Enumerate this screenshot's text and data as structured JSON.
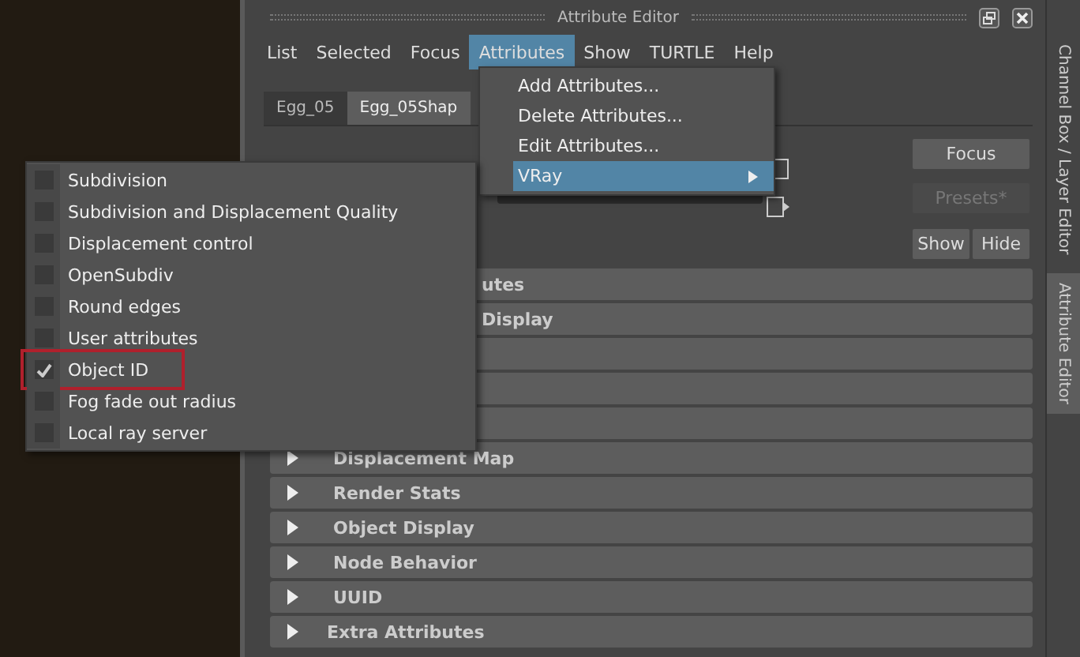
{
  "window": {
    "title": "Attribute Editor"
  },
  "menu_bar": [
    {
      "label": "List",
      "selected": false
    },
    {
      "label": "Selected",
      "selected": false
    },
    {
      "label": "Focus",
      "selected": false
    },
    {
      "label": "Attributes",
      "selected": true
    },
    {
      "label": "Show",
      "selected": false
    },
    {
      "label": "TURTLE",
      "selected": false
    },
    {
      "label": "Help",
      "selected": false
    }
  ],
  "attributes_menu": [
    {
      "label": "Add Attributes...",
      "selected": false,
      "submenu": false
    },
    {
      "label": "Delete Attributes...",
      "selected": false,
      "submenu": false
    },
    {
      "label": "Edit Attributes...",
      "selected": false,
      "submenu": false
    },
    {
      "label": "VRay",
      "selected": true,
      "submenu": true
    }
  ],
  "vray_submenu": [
    {
      "label": "Subdivision",
      "checked": false,
      "highlighted": false
    },
    {
      "label": "Subdivision and Displacement Quality",
      "checked": false,
      "highlighted": false
    },
    {
      "label": "Displacement control",
      "checked": false,
      "highlighted": false
    },
    {
      "label": "OpenSubdiv",
      "checked": false,
      "highlighted": false
    },
    {
      "label": "Round edges",
      "checked": false,
      "highlighted": false
    },
    {
      "label": "User attributes",
      "checked": false,
      "highlighted": false
    },
    {
      "label": "Object ID",
      "checked": true,
      "highlighted": true
    },
    {
      "label": "Fog fade out radius",
      "checked": false,
      "highlighted": false
    },
    {
      "label": "Local ray server",
      "checked": false,
      "highlighted": false
    }
  ],
  "node_tabs": [
    {
      "label": "Egg_05",
      "selected": false
    },
    {
      "label": "Egg_05Shap",
      "selected": true
    }
  ],
  "buttons": [
    {
      "label": "Focus",
      "disabled": false
    },
    {
      "label": "Presets*",
      "disabled": true
    },
    {
      "label": "Show",
      "disabled": false
    },
    {
      "label": "Hide",
      "disabled": false
    }
  ],
  "sections": [
    {
      "label": "utes",
      "kind": "partial"
    },
    {
      "label": "Display",
      "kind": "partial"
    },
    {
      "kind": "hidden"
    },
    {
      "kind": "hidden"
    },
    {
      "kind": "hidden"
    },
    {
      "label": "Displacement Map",
      "kind": "full"
    },
    {
      "label": "Render Stats",
      "kind": "full"
    },
    {
      "label": "Object Display",
      "kind": "full"
    },
    {
      "label": "Node Behavior",
      "kind": "full"
    },
    {
      "label": "UUID",
      "kind": "full"
    },
    {
      "label": "Extra Attributes",
      "kind": "extra"
    }
  ],
  "side_tabs": [
    {
      "label": "Channel Box / Layer Editor",
      "selected": false
    },
    {
      "label": "Attribute Editor",
      "selected": true
    }
  ]
}
